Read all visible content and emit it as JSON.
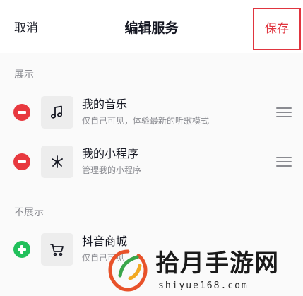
{
  "header": {
    "cancel_label": "取消",
    "title": "编辑服务",
    "save_label": "保存"
  },
  "sections": {
    "shown": {
      "label": "展示",
      "items": [
        {
          "title": "我的音乐",
          "desc": "仅自己可见，体验最新的听歌模式",
          "icon": "music-note-icon"
        },
        {
          "title": "我的小程序",
          "desc": "管理我的小程序",
          "icon": "mini-program-icon"
        }
      ]
    },
    "hidden": {
      "label": "不展示",
      "items": [
        {
          "title": "抖音商城",
          "desc": "仅自己可见",
          "icon": "shopping-cart-icon"
        }
      ]
    }
  },
  "watermark": {
    "title": "拾月手游网",
    "url": "shiyue168.com"
  },
  "colors": {
    "accent_red": "#e0353f",
    "remove_red": "#e8393f",
    "add_green": "#21c05b",
    "text_primary": "#161823",
    "text_secondary": "#8a8b91"
  }
}
